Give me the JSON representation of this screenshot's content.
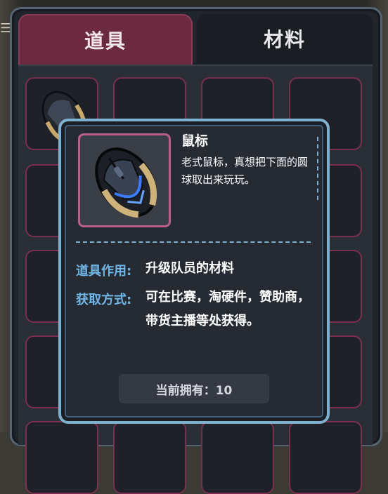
{
  "tabs": [
    {
      "label": "道具",
      "active": true
    },
    {
      "label": "材料",
      "active": false
    }
  ],
  "colors": {
    "accent_tab": "#6b2a3f",
    "slot_border": "#7a2f4c",
    "tooltip_border": "#7eb0cf",
    "label_blue": "#6fb6e6"
  },
  "tooltip": {
    "icon": "gaming-mouse-icon",
    "name": "鼠标",
    "description": "老式鼠标，真想把下面的圆球取出来玩玩。",
    "usage_label": "道具作用:",
    "usage_value": "升级队员的材料",
    "source_label": "获取方式:",
    "source_value": "可在比赛，淘硬件，赞助商，带货主播等处获得。",
    "owned_text": "当前拥有：10"
  }
}
